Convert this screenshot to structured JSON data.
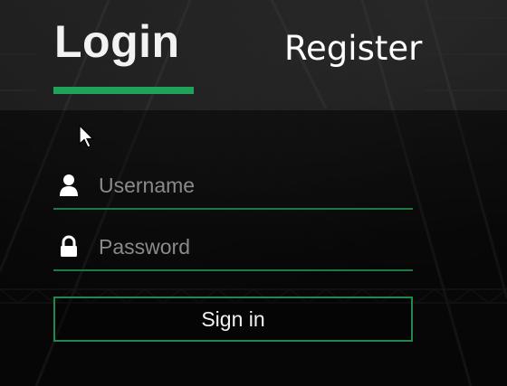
{
  "tabs": {
    "login_label": "Login",
    "register_label": "Register"
  },
  "form": {
    "username_placeholder": "Username",
    "username_value": "",
    "password_placeholder": "Password",
    "password_value": "",
    "signin_label": "Sign in"
  },
  "icons": {
    "username": "user-icon",
    "password": "lock-icon",
    "pointer": "mouse-cursor-icon"
  },
  "colors": {
    "accent": "#1fa35a",
    "field_underline": "#1e7a45",
    "button_border": "#1e8a4c",
    "text": "#f2f2f2",
    "placeholder": "#8a8a8a"
  }
}
